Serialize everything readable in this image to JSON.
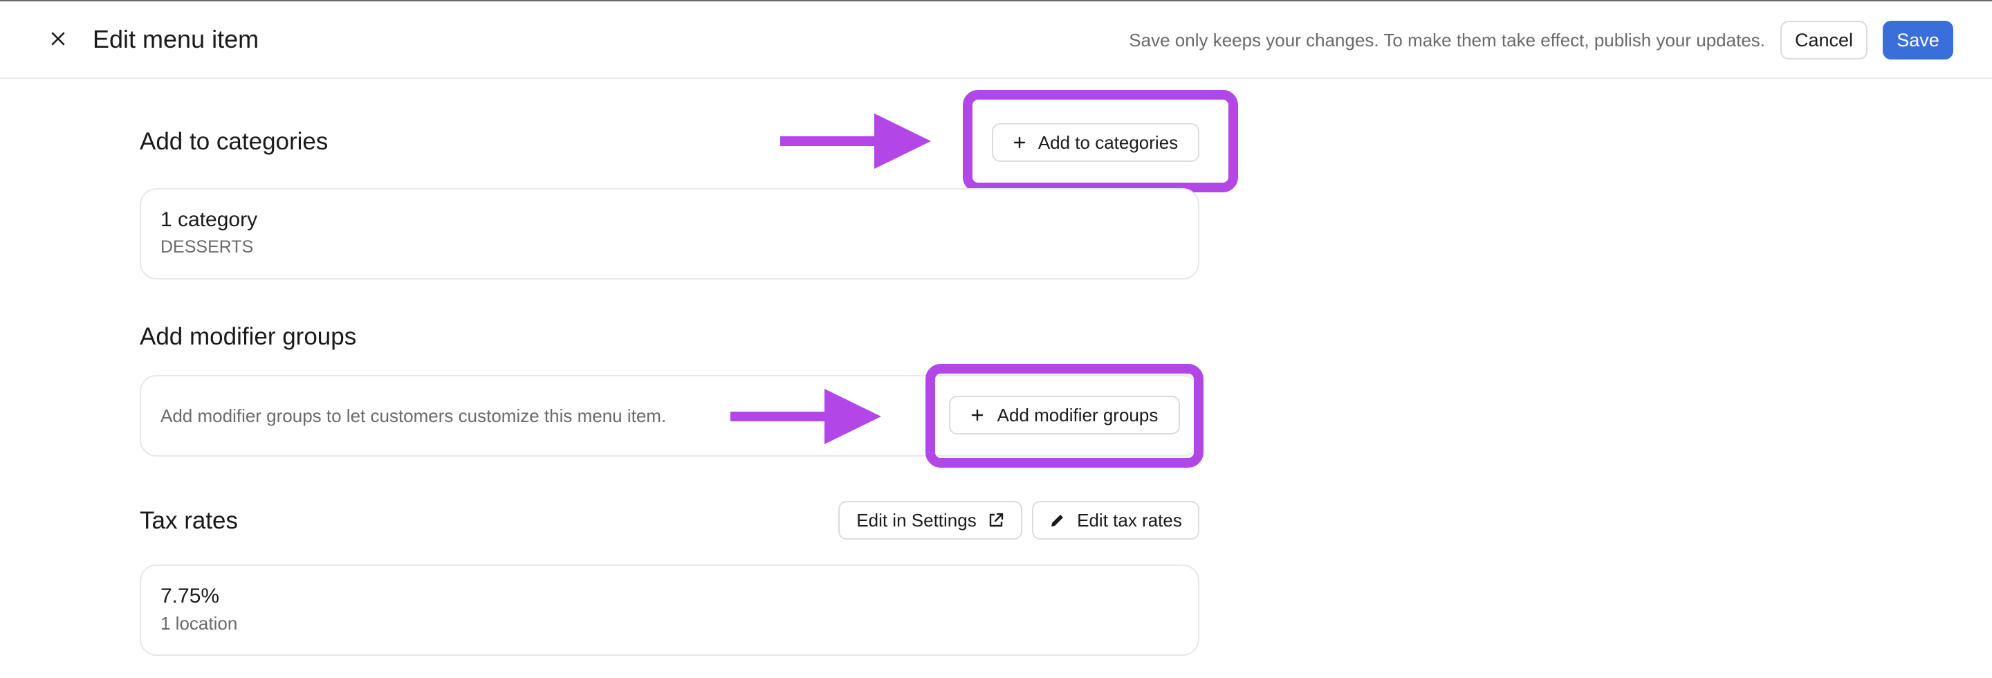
{
  "header": {
    "title": "Edit menu item",
    "notice": "Save only keeps your changes. To make them take effect, publish your updates.",
    "cancel_label": "Cancel",
    "save_label": "Save"
  },
  "categories": {
    "title": "Add to categories",
    "add_label": "Add to categories",
    "count": "1 category",
    "names": "DESSERTS"
  },
  "modifiers": {
    "title": "Add modifier groups",
    "empty_text": "Add modifier groups to let customers customize this menu item.",
    "add_label": "Add modifier groups"
  },
  "tax": {
    "title": "Tax rates",
    "edit_settings_label": "Edit in Settings",
    "edit_rates_label": "Edit tax rates",
    "rate": "7.75%",
    "locations": "1 location"
  },
  "annotation": {
    "color": "#b246e6"
  },
  "colors": {
    "primary": "#3a6fdb",
    "border": "#e8e8e8",
    "muted_text": "#6a6a6a"
  }
}
